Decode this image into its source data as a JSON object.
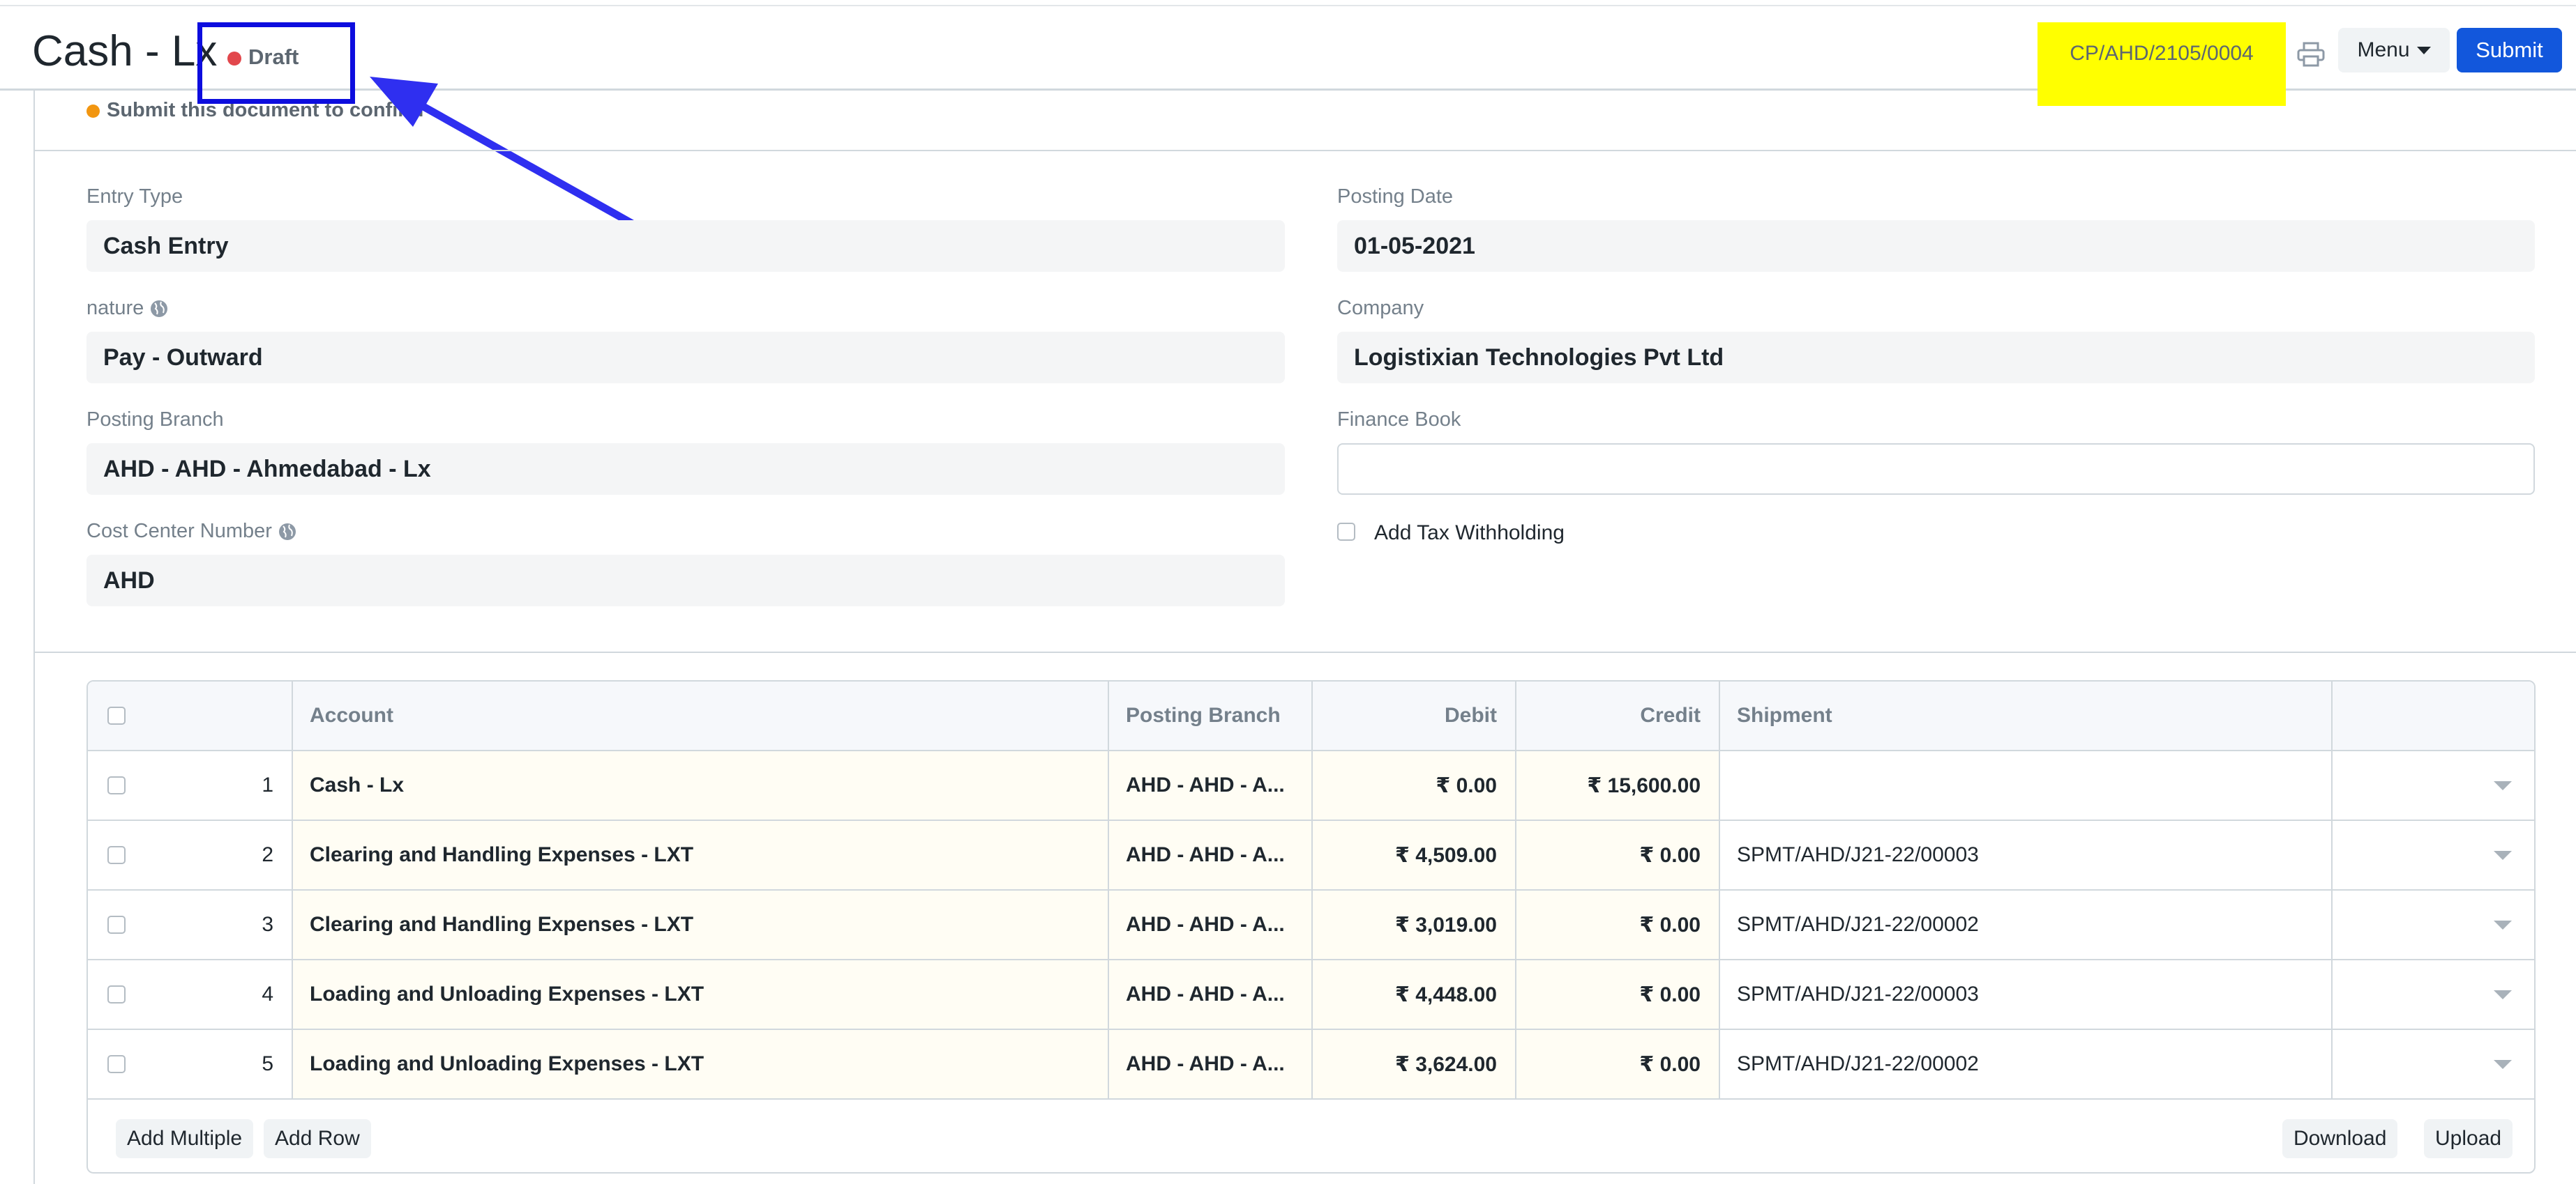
{
  "header": {
    "title": "Cash - Lx",
    "status": "Draft",
    "status_color": "#e2474c",
    "document_number": "CP/AHD/2105/0004",
    "menu_label": "Menu",
    "submit_label": "Submit",
    "accent": "#1257dc",
    "highlight_color": "#ffff00"
  },
  "indicator": {
    "text": "Submit this document to confirm",
    "color": "#f29610"
  },
  "form": {
    "entry_type": {
      "label": "Entry Type",
      "value": "Cash Entry"
    },
    "posting_date": {
      "label": "Posting Date",
      "value": "01-05-2021"
    },
    "nature": {
      "label": "nature",
      "value": "Pay - Outward"
    },
    "company": {
      "label": "Company",
      "value": "Logistixian Technologies Pvt Ltd"
    },
    "posting_branch": {
      "label": "Posting Branch",
      "value": "AHD - AHD - Ahmedabad - Lx"
    },
    "finance_book": {
      "label": "Finance Book",
      "value": ""
    },
    "cost_center": {
      "label": "Cost Center Number",
      "value": "AHD"
    },
    "tax_withholding": {
      "label": "Add Tax Withholding",
      "checked": false
    }
  },
  "grid": {
    "headers": {
      "account": "Account",
      "posting_branch": "Posting Branch",
      "debit": "Debit",
      "credit": "Credit",
      "shipment": "Shipment"
    },
    "rows": [
      {
        "idx": "1",
        "account": "Cash - Lx",
        "branch": "AHD - AHD - A...",
        "debit": "₹ 0.00",
        "credit": "₹ 15,600.00",
        "shipment": ""
      },
      {
        "idx": "2",
        "account": "Clearing and Handling Expenses - LXT",
        "branch": "AHD - AHD - A...",
        "debit": "₹ 4,509.00",
        "credit": "₹ 0.00",
        "shipment": "SPMT/AHD/J21-22/00003"
      },
      {
        "idx": "3",
        "account": "Clearing and Handling Expenses - LXT",
        "branch": "AHD - AHD - A...",
        "debit": "₹ 3,019.00",
        "credit": "₹ 0.00",
        "shipment": "SPMT/AHD/J21-22/00002"
      },
      {
        "idx": "4",
        "account": "Loading and Unloading Expenses - LXT",
        "branch": "AHD - AHD - A...",
        "debit": "₹ 4,448.00",
        "credit": "₹ 0.00",
        "shipment": "SPMT/AHD/J21-22/00003"
      },
      {
        "idx": "5",
        "account": "Loading and Unloading Expenses - LXT",
        "branch": "AHD - AHD - A...",
        "debit": "₹ 3,624.00",
        "credit": "₹ 0.00",
        "shipment": "SPMT/AHD/J21-22/00002"
      }
    ],
    "buttons": {
      "add_multiple": "Add Multiple",
      "add_row": "Add Row",
      "download": "Download",
      "upload": "Upload"
    }
  }
}
